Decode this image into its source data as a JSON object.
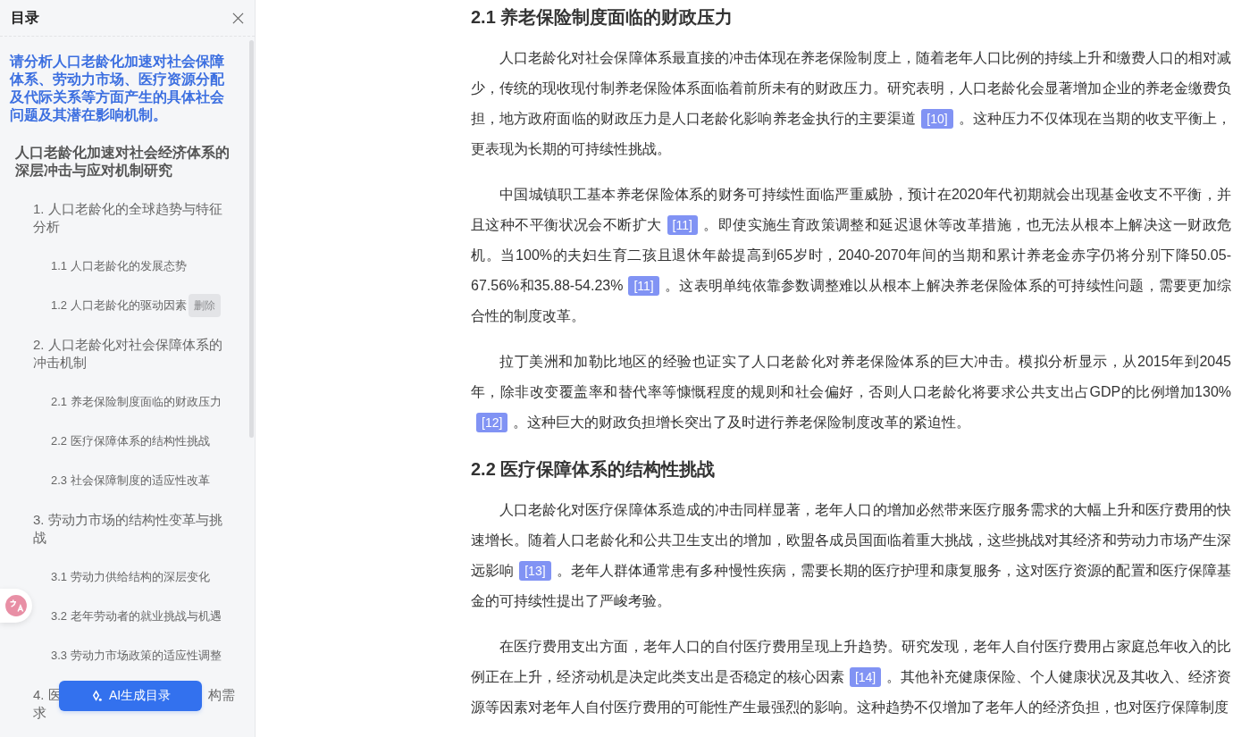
{
  "sidebar": {
    "title": "目录",
    "question": "请分析人口老龄化加速对社会保障体系、劳动力市场、医疗资源分配及代际关系等方面产生的具体社会问题及其潜在影响机制。",
    "toc": [
      {
        "label": "人口老龄化加速对社会经济体系的深层冲击与应对机制研究",
        "children": [
          {
            "label": "1. 人口老龄化的全球趋势与特征分析",
            "children": [
              {
                "label": "1.1 人口老龄化的发展态势"
              },
              {
                "label": "1.2 人口老龄化的驱动因素",
                "hover_action": "删除"
              }
            ]
          },
          {
            "label": "2. 人口老龄化对社会保障体系的冲击机制",
            "children": [
              {
                "label": "2.1 养老保险制度面临的财政压力"
              },
              {
                "label": "2.2 医疗保障体系的结构性挑战"
              },
              {
                "label": "2.3 社会保障制度的适应性改革"
              }
            ]
          },
          {
            "label": "3. 劳动力市场的结构性变革与挑战",
            "children": [
              {
                "label": "3.1 劳动力供给结构的深层变化"
              },
              {
                "label": "3.2 老年劳动者的就业挑战与机遇"
              },
              {
                "label": "3.3 劳动力市场政策的适应性调整"
              }
            ]
          },
          {
            "label": "4. 医",
            "label_after_cover": "构需",
            "label_line_2": "求"
          }
        ]
      }
    ],
    "ai_button": "AI生成目录"
  },
  "content": [
    {
      "kind": "heading",
      "text": "2.1 养老保险制度面临的财政压力"
    },
    {
      "kind": "paragraph",
      "segments": [
        {
          "text": "人口老龄化对社会保障体系最直接的冲击体现在养老保险制度上，随着老年人口比例的持续上升和缴费人口的相对减少，传统的现收现付制养老保险体系面临着前所未有的财政压力。研究表明，人口老龄化会显著增加企业的养老金缴费负担，地方政府面临的财政压力是人口老龄化影响养老金执行的主要渠道"
        },
        {
          "cite": "[10]"
        },
        {
          "text": "。这种压力不仅体现在当期的收支平衡上，更表现为长期的可持续性挑战。"
        }
      ]
    },
    {
      "kind": "paragraph",
      "segments": [
        {
          "text": "中国城镇职工基本养老保险体系的财务可持续性面临严重威胁，预计在2020年代初期就会出现基金收支不平衡，并且这种不平衡状况会不断扩大"
        },
        {
          "cite": "[11]"
        },
        {
          "text": "。即使实施生育政策调整和延迟退休等改革措施，也无法从根本上解决这一财政危机。当100%的夫妇生育二孩且退休年龄提高到65岁时，2040-2070年间的当期和累计养老金赤字仍将分别下降50.05-67.56%和35.88-54.23%"
        },
        {
          "cite": "[11]"
        },
        {
          "text": "。这表明单纯依靠参数调整难以从根本上解决养老保险体系的可持续性问题，需要更加综合性的制度改革。"
        }
      ]
    },
    {
      "kind": "paragraph",
      "segments": [
        {
          "text": "拉丁美洲和加勒比地区的经验也证实了人口老龄化对养老保险体系的巨大冲击。模拟分析显示，从2015年到2045年，除非改变覆盖率和替代率等慷慨程度的规则和社会偏好，否则人口老龄化将要求公共支出占GDP的比例增加130%"
        },
        {
          "cite": "[12]"
        },
        {
          "text": "。这种巨大的财政负担增长突出了及时进行养老保险制度改革的紧迫性。"
        }
      ]
    },
    {
      "kind": "heading",
      "text": "2.2 医疗保障体系的结构性挑战"
    },
    {
      "kind": "paragraph",
      "segments": [
        {
          "text": "人口老龄化对医疗保障体系造成的冲击同样显著，老年人口的增加必然带来医疗服务需求的大幅上升和医疗费用的快速增长。随着人口老龄化和公共卫生支出的增加，欧盟各成员国面临着重大挑战，这些挑战对其经济和劳动力市场产生深远影响"
        },
        {
          "cite": "[13]"
        },
        {
          "text": "。老年人群体通常患有多种慢性疾病，需要长期的医疗护理和康复服务，这对医疗资源的配置和医疗保障基金的可持续性提出了严峻考验。"
        }
      ]
    },
    {
      "kind": "paragraph",
      "segments": [
        {
          "text": "在医疗费用支出方面，老年人口的自付医疗费用呈现上升趋势。研究发现，老年人自付医疗费用占家庭总年收入的比例正在上升，经济动机是决定此类支出是否稳定的核心因素"
        },
        {
          "cite": "[14]"
        },
        {
          "text": "。其他补充健康保险、个人健康状况及其收入、经济资源等因素对老年人自付医疗费用的可能性产生最强烈的影响。这种趋势不仅增加了老年人的经济负担，也对医疗保障制度"
        }
      ]
    }
  ]
}
